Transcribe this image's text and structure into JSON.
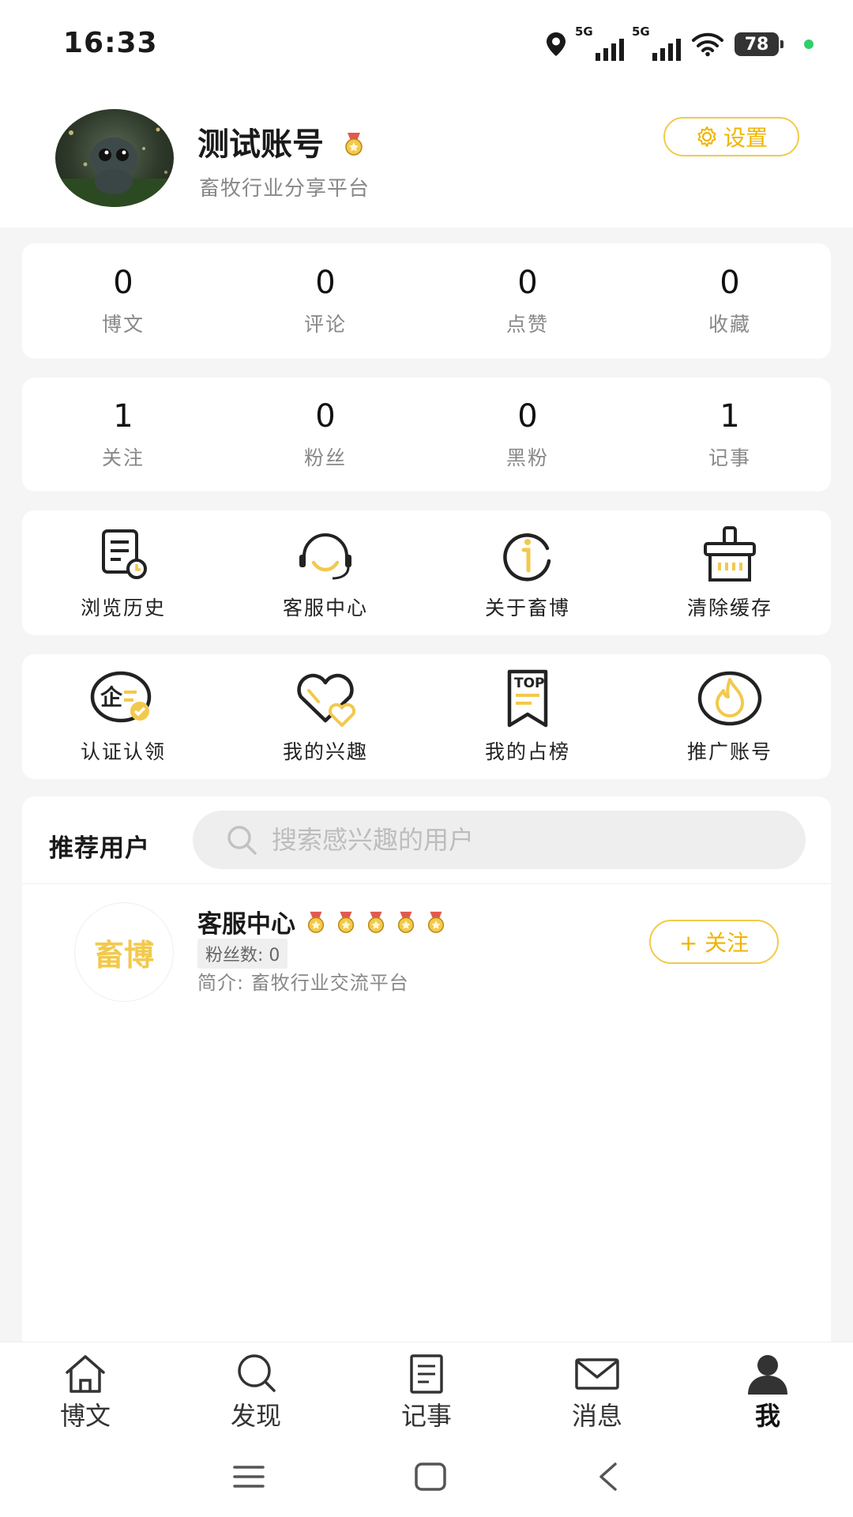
{
  "status_bar": {
    "time": "16:33",
    "network1": "5G",
    "network2": "5G",
    "battery": "78"
  },
  "profile": {
    "name": "测试账号",
    "subtitle": "畜牧行业分享平台",
    "settings_label": "设置"
  },
  "stats_row1": [
    {
      "value": "0",
      "label": "博文"
    },
    {
      "value": "0",
      "label": "评论"
    },
    {
      "value": "0",
      "label": "点赞"
    },
    {
      "value": "0",
      "label": "收藏"
    }
  ],
  "stats_row2": [
    {
      "value": "1",
      "label": "关注"
    },
    {
      "value": "0",
      "label": "粉丝"
    },
    {
      "value": "0",
      "label": "黑粉"
    },
    {
      "value": "1",
      "label": "记事"
    }
  ],
  "menu_row1": [
    {
      "label": "浏览历史",
      "icon": "history-icon"
    },
    {
      "label": "客服中心",
      "icon": "headset-icon"
    },
    {
      "label": "关于畜博",
      "icon": "info-icon"
    },
    {
      "label": "清除缓存",
      "icon": "clear-cache-icon"
    }
  ],
  "menu_row2": [
    {
      "label": "认证认领",
      "icon": "certify-icon"
    },
    {
      "label": "我的兴趣",
      "icon": "interest-heart-icon"
    },
    {
      "label": "我的占榜",
      "icon": "top-ranking-icon"
    },
    {
      "label": "推广账号",
      "icon": "promote-flame-icon"
    }
  ],
  "recommend": {
    "title": "推荐用户",
    "search_placeholder": "搜索感兴趣的用户",
    "users": [
      {
        "logo_text": "畜博",
        "name": "客服中心",
        "fans": "粉丝数: 0",
        "intro": "简介:  畜牧行业交流平台",
        "follow_label": "+ 关注"
      }
    ]
  },
  "bottom_nav": [
    {
      "label": "博文",
      "icon": "home-icon"
    },
    {
      "label": "发现",
      "icon": "search-icon"
    },
    {
      "label": "记事",
      "icon": "notes-icon"
    },
    {
      "label": "消息",
      "icon": "mail-icon"
    },
    {
      "label": "我",
      "icon": "profile-icon"
    }
  ],
  "colors": {
    "accent": "#f2c94c",
    "accent_text": "#f0b400",
    "background": "#f5f5f5"
  }
}
